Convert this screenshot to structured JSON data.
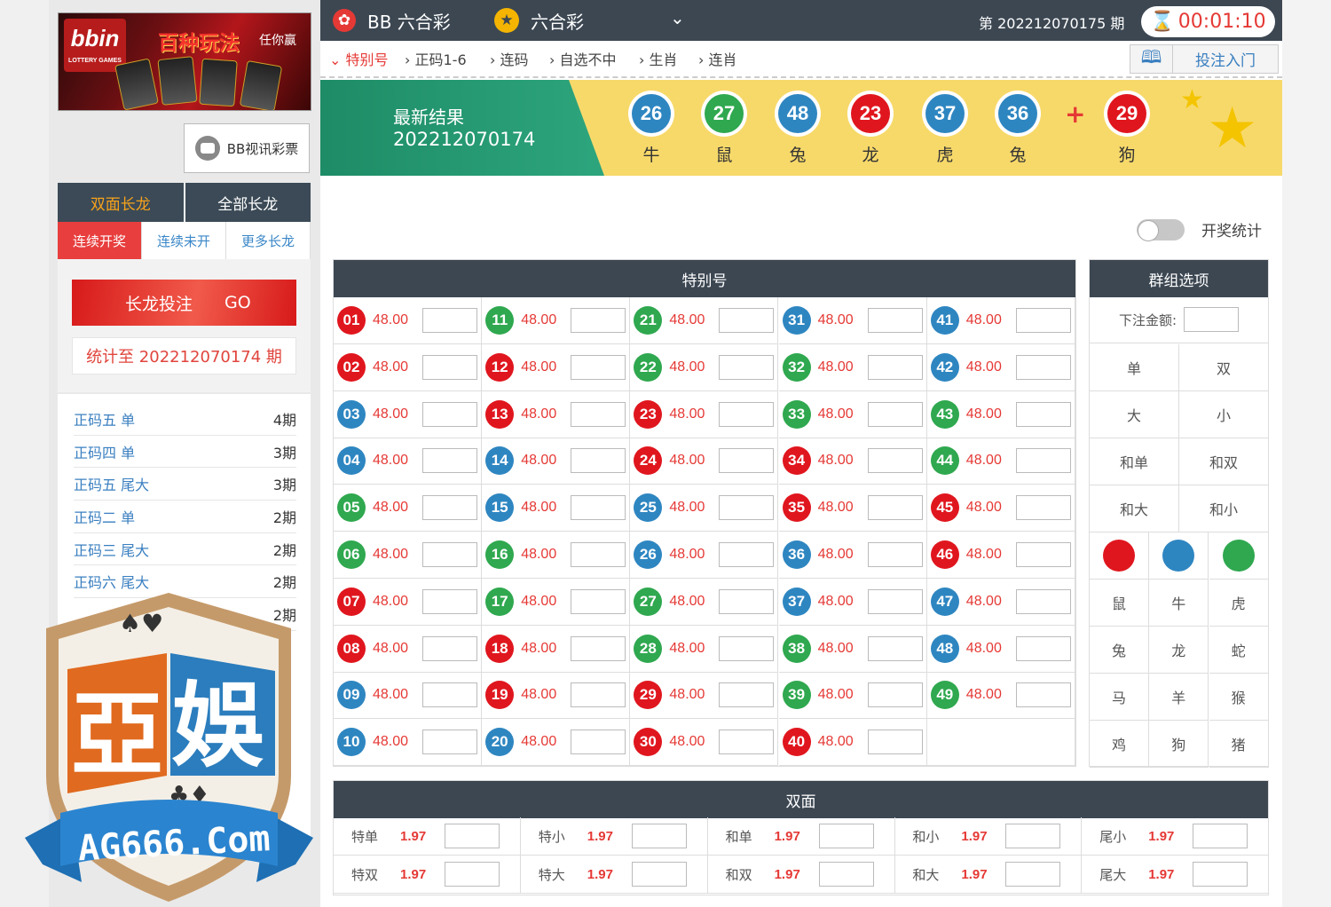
{
  "left": {
    "banner_headline": "百种玩法",
    "banner_headline2": "任你赢",
    "banner_logo": "bbin",
    "banner_logo_sub": "LOTTERY GAMES",
    "video_btn": "BB视讯彩票",
    "long_tabs": [
      "双面长龙",
      "全部长龙"
    ],
    "sub_tabs": [
      "连续开奖",
      "连续未开",
      "更多长龙"
    ],
    "long_bet": "长龙投注",
    "long_go": "GO",
    "stat_line": "统计至 202212070174 期",
    "streaks": [
      {
        "name": "正码五 单",
        "count": "4期"
      },
      {
        "name": "正码四 单",
        "count": "3期"
      },
      {
        "name": "正码五 尾大",
        "count": "3期"
      },
      {
        "name": "正码二 单",
        "count": "2期"
      },
      {
        "name": "正码三 尾大",
        "count": "2期"
      },
      {
        "name": "正码六 尾大",
        "count": "2期"
      },
      {
        "name": "",
        "count": "2期"
      }
    ]
  },
  "watermark": {
    "cn1": "亞",
    "cn2": "娛",
    "url": "AG666.Com"
  },
  "header": {
    "app_title": "BB 六合彩",
    "game_name": "六合彩",
    "issue": "第 202212070175 期",
    "timer": "00:01:10"
  },
  "nav": {
    "items": [
      "特别号",
      "正码1-6",
      "连码",
      "自选不中",
      "生肖",
      "连肖"
    ],
    "guide": "投注入门"
  },
  "result": {
    "title": "最新结果",
    "issue": "202212070174",
    "balls": [
      {
        "num": "26",
        "zodiac": "牛",
        "color": "#2e86c1"
      },
      {
        "num": "27",
        "zodiac": "鼠",
        "color": "#2fa84f"
      },
      {
        "num": "48",
        "zodiac": "兔",
        "color": "#2e86c1"
      },
      {
        "num": "23",
        "zodiac": "龙",
        "color": "#e0161e"
      },
      {
        "num": "37",
        "zodiac": "虎",
        "color": "#2e86c1"
      },
      {
        "num": "36",
        "zodiac": "兔",
        "color": "#2e86c1"
      }
    ],
    "plus": "+",
    "special": {
      "num": "29",
      "zodiac": "狗",
      "color": "#e0161e"
    }
  },
  "toggle_label": "开奖统计",
  "special_panel": {
    "title": "特别号",
    "odds": "48.00",
    "colors": {
      "red": "#e0161e",
      "blue": "#2e86c1",
      "green": "#2fa84f"
    },
    "numbers": [
      {
        "n": "01",
        "c": "red"
      },
      {
        "n": "02",
        "c": "red"
      },
      {
        "n": "03",
        "c": "blue"
      },
      {
        "n": "04",
        "c": "blue"
      },
      {
        "n": "05",
        "c": "green"
      },
      {
        "n": "06",
        "c": "green"
      },
      {
        "n": "07",
        "c": "red"
      },
      {
        "n": "08",
        "c": "red"
      },
      {
        "n": "09",
        "c": "blue"
      },
      {
        "n": "10",
        "c": "blue"
      },
      {
        "n": "11",
        "c": "green"
      },
      {
        "n": "12",
        "c": "red"
      },
      {
        "n": "13",
        "c": "red"
      },
      {
        "n": "14",
        "c": "blue"
      },
      {
        "n": "15",
        "c": "blue"
      },
      {
        "n": "16",
        "c": "green"
      },
      {
        "n": "17",
        "c": "green"
      },
      {
        "n": "18",
        "c": "red"
      },
      {
        "n": "19",
        "c": "red"
      },
      {
        "n": "20",
        "c": "blue"
      },
      {
        "n": "21",
        "c": "green"
      },
      {
        "n": "22",
        "c": "green"
      },
      {
        "n": "23",
        "c": "red"
      },
      {
        "n": "24",
        "c": "red"
      },
      {
        "n": "25",
        "c": "blue"
      },
      {
        "n": "26",
        "c": "blue"
      },
      {
        "n": "27",
        "c": "green"
      },
      {
        "n": "28",
        "c": "green"
      },
      {
        "n": "29",
        "c": "red"
      },
      {
        "n": "30",
        "c": "red"
      },
      {
        "n": "31",
        "c": "blue"
      },
      {
        "n": "32",
        "c": "green"
      },
      {
        "n": "33",
        "c": "green"
      },
      {
        "n": "34",
        "c": "red"
      },
      {
        "n": "35",
        "c": "red"
      },
      {
        "n": "36",
        "c": "blue"
      },
      {
        "n": "37",
        "c": "blue"
      },
      {
        "n": "38",
        "c": "green"
      },
      {
        "n": "39",
        "c": "green"
      },
      {
        "n": "40",
        "c": "red"
      },
      {
        "n": "41",
        "c": "blue"
      },
      {
        "n": "42",
        "c": "blue"
      },
      {
        "n": "43",
        "c": "green"
      },
      {
        "n": "44",
        "c": "green"
      },
      {
        "n": "45",
        "c": "red"
      },
      {
        "n": "46",
        "c": "red"
      },
      {
        "n": "47",
        "c": "blue"
      },
      {
        "n": "48",
        "c": "blue"
      },
      {
        "n": "49",
        "c": "green"
      }
    ]
  },
  "group_panel": {
    "title": "群组选项",
    "amount_label": "下注金额:",
    "pairs": [
      [
        "单",
        "双"
      ],
      [
        "大",
        "小"
      ],
      [
        "和单",
        "和双"
      ],
      [
        "和大",
        "和小"
      ]
    ],
    "zodiacs": [
      [
        "鼠",
        "牛",
        "虎"
      ],
      [
        "兔",
        "龙",
        "蛇"
      ],
      [
        "马",
        "羊",
        "猴"
      ],
      [
        "鸡",
        "狗",
        "猪"
      ]
    ]
  },
  "two_sided": {
    "title": "双面",
    "items": [
      {
        "label": "特单",
        "odds": "1.97"
      },
      {
        "label": "特小",
        "odds": "1.97"
      },
      {
        "label": "和单",
        "odds": "1.97"
      },
      {
        "label": "和小",
        "odds": "1.97"
      },
      {
        "label": "尾小",
        "odds": "1.97"
      },
      {
        "label": "特双",
        "odds": "1.97"
      },
      {
        "label": "特大",
        "odds": "1.97"
      },
      {
        "label": "和双",
        "odds": "1.97"
      },
      {
        "label": "和大",
        "odds": "1.97"
      },
      {
        "label": "尾大",
        "odds": "1.97"
      }
    ]
  }
}
